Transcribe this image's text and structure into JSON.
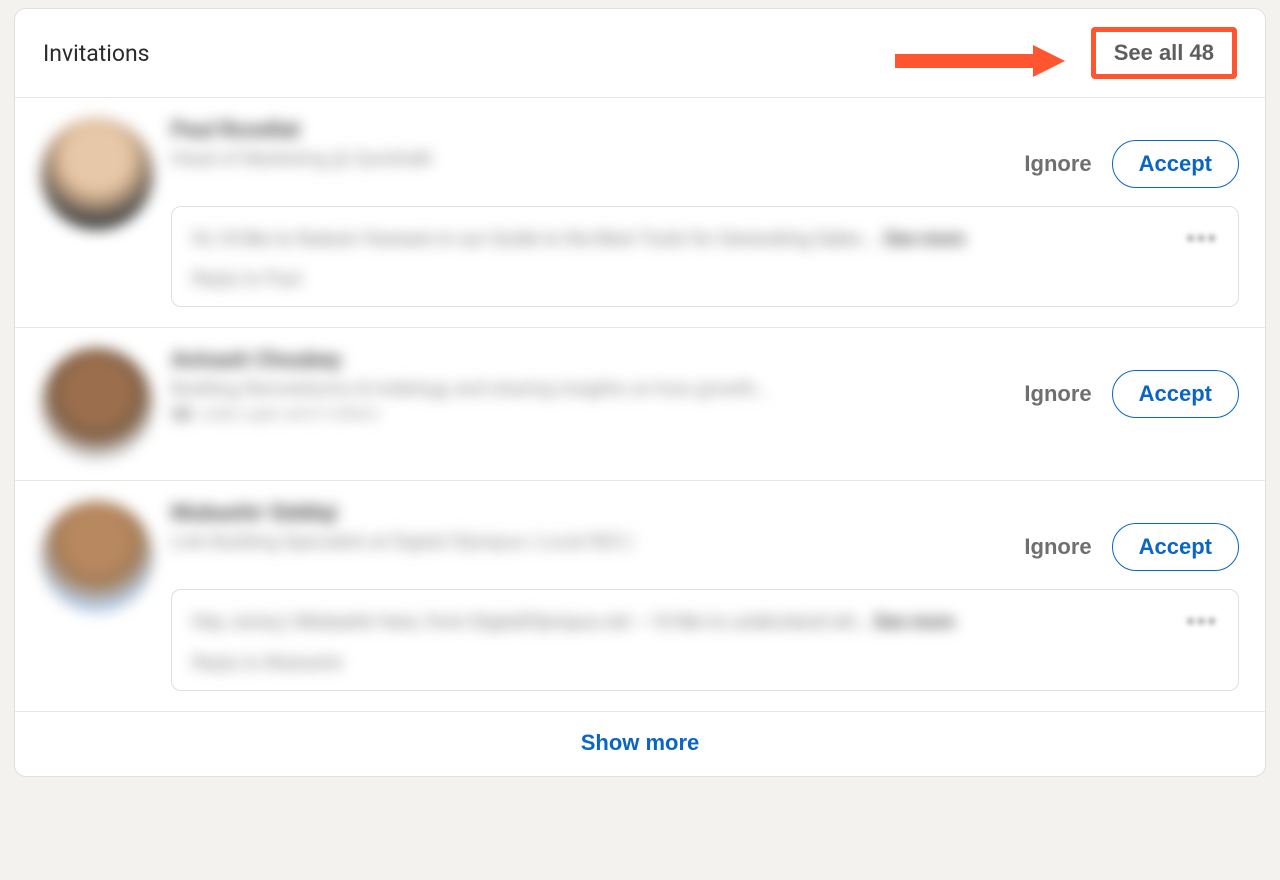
{
  "header": {
    "title": "Invitations",
    "see_all": "See all 48"
  },
  "actions": {
    "ignore": "Ignore",
    "accept": "Accept"
  },
  "invitations": [
    {
      "name": "Paul Rovellat",
      "headline": "Head of Marketing @ Quicktalk",
      "message": "Hi, I'd like to feature Yesware in our Guide to the Best Tools for Generating Sales …",
      "see_more": "See more",
      "reply": "Reply to Paul"
    },
    {
      "name": "Avinash Choubey",
      "headline": "Building Remotetoms & Indielogy and sharing insights on how growth…",
      "mutual": "Judy Lujan and 3 others"
    },
    {
      "name": "Mubashir Siddiqi",
      "headline": "Link Building Specialist at Digital Olympus | Local SEO |",
      "message": "Hey Jonny:) Mubashir here, from DigitalOlympus.net – I'd like to understand wh…",
      "see_more": "See more",
      "reply": "Reply to Mubashir"
    }
  ],
  "footer": {
    "show_more": "Show more"
  }
}
